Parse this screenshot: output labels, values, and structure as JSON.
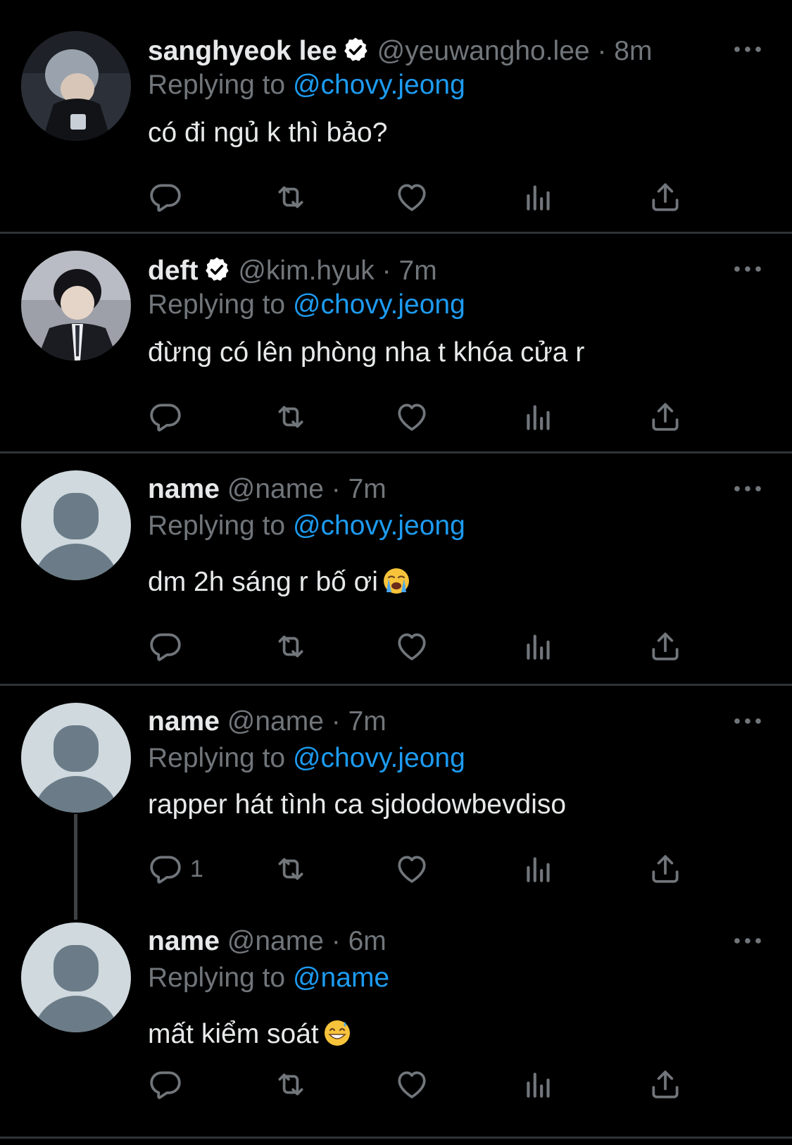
{
  "colors": {
    "background": "#000000",
    "text": "#e7e9ea",
    "muted": "#71767b",
    "link": "#1d9bf0",
    "separator": "#2f3336"
  },
  "tweets": [
    {
      "name": "sanghyeok lee",
      "verified": true,
      "handle": "@yeuwangho.lee",
      "dot": "·",
      "time": "8m",
      "replying_prefix": "Replying to",
      "replying_to": "@chovy.jeong",
      "text": "có đi ngủ k thì bảo?",
      "reply_count": "",
      "avatar": "photo-avatar"
    },
    {
      "name": "deft",
      "verified": true,
      "handle": "@kim.hyuk",
      "dot": "·",
      "time": "7m",
      "replying_prefix": "Replying to",
      "replying_to": "@chovy.jeong",
      "text": "đừng có lên phòng nha t khóa cửa r",
      "reply_count": "",
      "avatar": "photo-avatar"
    },
    {
      "name": "name",
      "verified": false,
      "handle": "@name",
      "dot": "·",
      "time": "7m",
      "replying_prefix": "Replying to",
      "replying_to": "@chovy.jeong",
      "text": "dm 2h sáng r bố ơi",
      "emoji": "loudly-crying-face",
      "reply_count": "",
      "avatar": "default-avatar"
    },
    {
      "name": "name",
      "verified": false,
      "handle": "@name",
      "dot": "·",
      "time": "7m",
      "replying_prefix": "Replying to",
      "replying_to": "@chovy.jeong",
      "text": "rapper hát tình ca sjdodowbevdiso",
      "reply_count": "1",
      "avatar": "default-avatar"
    },
    {
      "name": "name",
      "verified": false,
      "handle": "@name",
      "dot": "·",
      "time": "6m",
      "replying_prefix": "Replying to",
      "replying_to": "@name",
      "text": "mất kiểm soát",
      "emoji": "grinning-face-with-sweat",
      "reply_count": "",
      "avatar": "default-avatar"
    }
  ],
  "icons": [
    "reply-icon",
    "retweet-icon",
    "like-icon",
    "analytics-icon",
    "share-icon",
    "more-icon",
    "verified-badge-icon"
  ]
}
